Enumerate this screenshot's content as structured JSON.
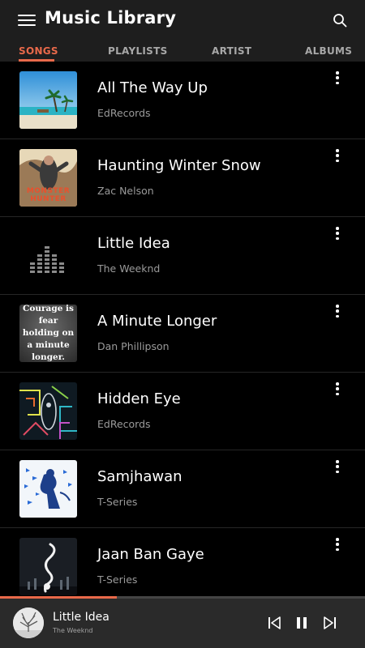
{
  "header": {
    "title": "Music Library",
    "menu_icon": "menu-icon",
    "search_icon": "search-icon"
  },
  "tabs": [
    {
      "label": "SONGS",
      "active": true
    },
    {
      "label": "PLAYLISTS",
      "active": false
    },
    {
      "label": "ARTIST",
      "active": false
    },
    {
      "label": "ALBUMS",
      "active": false
    }
  ],
  "songs": [
    {
      "title": "All The Way Up",
      "artist": "EdRecords"
    },
    {
      "title": "Haunting Winter Snow",
      "artist": "Zac Nelson",
      "art_text": "MONSTER HUNTER"
    },
    {
      "title": "Little Idea",
      "artist": "The Weeknd"
    },
    {
      "title": "A Minute Longer",
      "artist": "Dan Phillipson",
      "art_text": "Courage is fear holding on a minute longer."
    },
    {
      "title": "Hidden Eye",
      "artist": "EdRecords"
    },
    {
      "title": "Samjhawan",
      "artist": "T-Series"
    },
    {
      "title": "Jaan Ban Gaye",
      "artist": "T-Series"
    }
  ],
  "now_playing": {
    "title": "Little Idea",
    "artist": "The Weeknd",
    "progress": 0.32
  },
  "colors": {
    "accent": "#e9694a",
    "background": "#000000",
    "header": "#1e1e1e",
    "player": "#2a2a2a"
  }
}
